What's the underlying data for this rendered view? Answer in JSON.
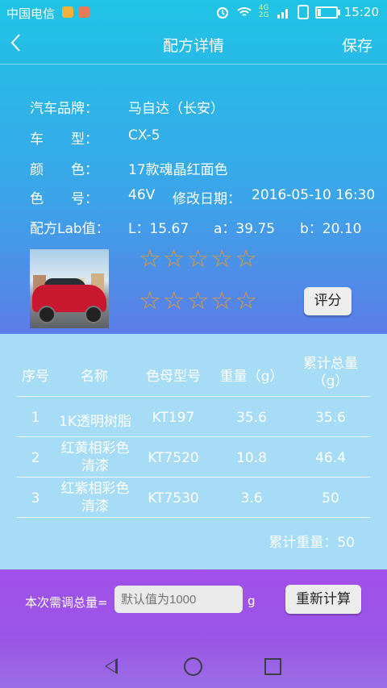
{
  "status_bar": {
    "carrier": "中国电信",
    "time": "15:20",
    "network": "4G 2G"
  },
  "header": {
    "title": "配方详情",
    "save_label": "保存"
  },
  "info": {
    "brand_label": "汽车品牌：",
    "brand_value": "马自达（长安）",
    "model_label": "车　　型：",
    "model_value": "CX-5",
    "color_label": "颜　　色：",
    "color_value": "17款魂晶红面色",
    "code_label": "色　　号：",
    "code_value": "46V",
    "date_label": "修改日期：",
    "date_value": "2016-05-10 16:30",
    "lab_label": "配方Lab值：",
    "lab_l": "L：15.67",
    "lab_a": "a：39.75",
    "lab_b": "b：20.10"
  },
  "rating": {
    "row1_stars": 0,
    "row2_stars": 0,
    "max_stars": 5,
    "rate_button": "评分"
  },
  "table": {
    "headers": [
      "序号",
      "名称",
      "色母型号",
      "重量（g）",
      "累计总量（g）"
    ],
    "rows": [
      [
        "1",
        "1K透明树脂",
        "KT197",
        "35.6",
        "35.6"
      ],
      [
        "2",
        "红黄相彩色清漆",
        "KT7520",
        "10.8",
        "46.4"
      ],
      [
        "3",
        "红紫相彩色清漆",
        "KT7530",
        "3.6",
        "50"
      ]
    ],
    "total_label": "累计重量：",
    "total_value": "50"
  },
  "bottom": {
    "need_label": "本次需调总量=",
    "input_placeholder": "默认值为1000",
    "unit": "g",
    "recalc_button": "重新计算"
  },
  "colors": {
    "star": "#e39a2c",
    "top_gradient_start": "#1fc4e6",
    "table_bg": "#a6dcf5",
    "bottom_bg": "#a24fe9"
  }
}
